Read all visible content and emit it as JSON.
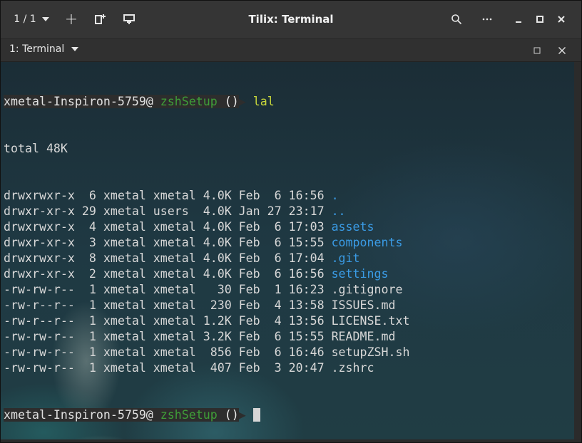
{
  "titlebar": {
    "session_label": "1 / 1",
    "new_session_icon": "plus-icon",
    "title": "Tilix: Terminal"
  },
  "tab": {
    "label": "1: Terminal"
  },
  "prompt": {
    "host": "xmetal-Inspiron-5759@",
    "dir": "zshSetup",
    "git": "()"
  },
  "command": "lal",
  "total": "total 48K",
  "listing": [
    {
      "perm": "drwxrwxr-x",
      "links": " 6",
      "owner": "xmetal",
      "group": "xmetal",
      "size": "4.0K",
      "month": "Feb",
      "day": " 6",
      "time": "16:56",
      "name": ".",
      "dir": true
    },
    {
      "perm": "drwxr-xr-x",
      "links": "29",
      "owner": "xmetal",
      "group": "users ",
      "size": "4.0K",
      "month": "Jan",
      "day": "27",
      "time": "23:17",
      "name": "..",
      "dir": true
    },
    {
      "perm": "drwxrwxr-x",
      "links": " 4",
      "owner": "xmetal",
      "group": "xmetal",
      "size": "4.0K",
      "month": "Feb",
      "day": " 6",
      "time": "17:03",
      "name": "assets",
      "dir": true
    },
    {
      "perm": "drwxr-xr-x",
      "links": " 3",
      "owner": "xmetal",
      "group": "xmetal",
      "size": "4.0K",
      "month": "Feb",
      "day": " 6",
      "time": "15:55",
      "name": "components",
      "dir": true
    },
    {
      "perm": "drwxrwxr-x",
      "links": " 8",
      "owner": "xmetal",
      "group": "xmetal",
      "size": "4.0K",
      "month": "Feb",
      "day": " 6",
      "time": "17:04",
      "name": ".git",
      "dir": true
    },
    {
      "perm": "drwxr-xr-x",
      "links": " 2",
      "owner": "xmetal",
      "group": "xmetal",
      "size": "4.0K",
      "month": "Feb",
      "day": " 6",
      "time": "16:56",
      "name": "settings",
      "dir": true
    },
    {
      "perm": "-rw-rw-r--",
      "links": " 1",
      "owner": "xmetal",
      "group": "xmetal",
      "size": "  30",
      "month": "Feb",
      "day": " 1",
      "time": "16:23",
      "name": ".gitignore",
      "dir": false
    },
    {
      "perm": "-rw-r--r--",
      "links": " 1",
      "owner": "xmetal",
      "group": "xmetal",
      "size": " 230",
      "month": "Feb",
      "day": " 4",
      "time": "13:58",
      "name": "ISSUES.md",
      "dir": false
    },
    {
      "perm": "-rw-r--r--",
      "links": " 1",
      "owner": "xmetal",
      "group": "xmetal",
      "size": "1.2K",
      "month": "Feb",
      "day": " 4",
      "time": "13:56",
      "name": "LICENSE.txt",
      "dir": false
    },
    {
      "perm": "-rw-rw-r--",
      "links": " 1",
      "owner": "xmetal",
      "group": "xmetal",
      "size": "3.2K",
      "month": "Feb",
      "day": " 6",
      "time": "15:55",
      "name": "README.md",
      "dir": false
    },
    {
      "perm": "-rw-rw-r--",
      "links": " 1",
      "owner": "xmetal",
      "group": "xmetal",
      "size": " 856",
      "month": "Feb",
      "day": " 6",
      "time": "16:46",
      "name": "setupZSH.sh",
      "dir": false
    },
    {
      "perm": "-rw-rw-r--",
      "links": " 1",
      "owner": "xmetal",
      "group": "xmetal",
      "size": " 407",
      "month": "Feb",
      "day": " 3",
      "time": "20:47",
      "name": ".zshrc",
      "dir": false
    }
  ],
  "colors": {
    "dir": "#3a9be5",
    "command": "#c7d63b",
    "prompt_dir": "#3f9e38"
  }
}
